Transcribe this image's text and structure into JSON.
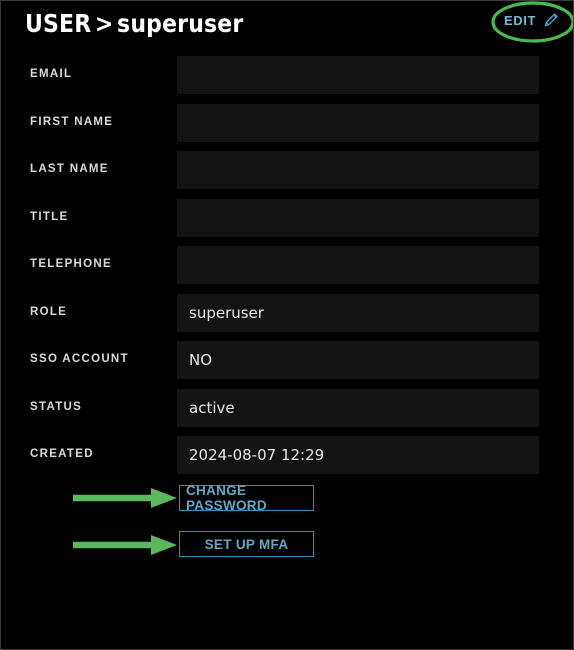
{
  "window": {
    "background_color": "#000000",
    "border_color": "#3a3a3a"
  },
  "header": {
    "breadcrumb_root": "USER",
    "breadcrumb_separator": ">",
    "breadcrumb_current": "superuser",
    "edit_label": "EDIT",
    "edit_icon": "pencil-icon",
    "edit_text_color": "#73b6d4"
  },
  "form": {
    "rows": [
      {
        "label": "EMAIL",
        "value": ""
      },
      {
        "label": "FIRST NAME",
        "value": ""
      },
      {
        "label": "LAST NAME",
        "value": ""
      },
      {
        "label": "TITLE",
        "value": ""
      },
      {
        "label": "TELEPHONE",
        "value": ""
      },
      {
        "label": "ROLE",
        "value": "superuser"
      },
      {
        "label": "SSO ACCOUNT",
        "value": "NO"
      },
      {
        "label": "STATUS",
        "value": "active"
      },
      {
        "label": "CREATED",
        "value": "2024-08-07 12:29"
      }
    ]
  },
  "actions": {
    "change_password_label": "CHANGE PASSWORD",
    "setup_mfa_label": "SET UP MFA",
    "button_border_color": "#2a93c4",
    "button_text_color": "#64a8c9"
  },
  "annotations": {
    "highlight_color": "#4cb94c",
    "arrow_color": "#5cb85c",
    "ellipse_target": "EDIT",
    "arrow_targets": [
      "CHANGE PASSWORD",
      "SET UP MFA"
    ]
  }
}
